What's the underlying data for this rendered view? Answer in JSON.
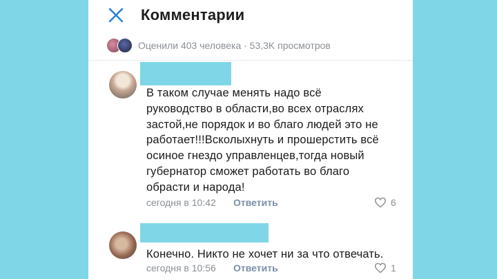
{
  "header": {
    "title": "Комментарии",
    "close_icon": "close-icon"
  },
  "stats": {
    "text": "Оценили 403 человека · 53,3K просмотров"
  },
  "comments": [
    {
      "lines": [
        "В таком случае менять надо всё",
        "руководство в области,во всех отраслях",
        "застой,не порядок и во благо людей это не",
        "работает!!!Всколыхнуть и прошерстить всё",
        "осиное гнездо управленцев,тогда новый",
        "губернатор сможет работать во благо",
        "обрасти и народа!"
      ],
      "timestamp": "сегодня в 10:42",
      "reply_label": "Ответить",
      "likes": "6"
    },
    {
      "lines": [
        "Конечно. Никто не хочет ни за что отвечать."
      ],
      "timestamp": "сегодня в 10:56",
      "reply_label": "Ответить",
      "likes": "1"
    }
  ],
  "colors": {
    "background": "#7fd6e6",
    "accent": "#2a82d8",
    "redaction": "#7fd6e6"
  }
}
